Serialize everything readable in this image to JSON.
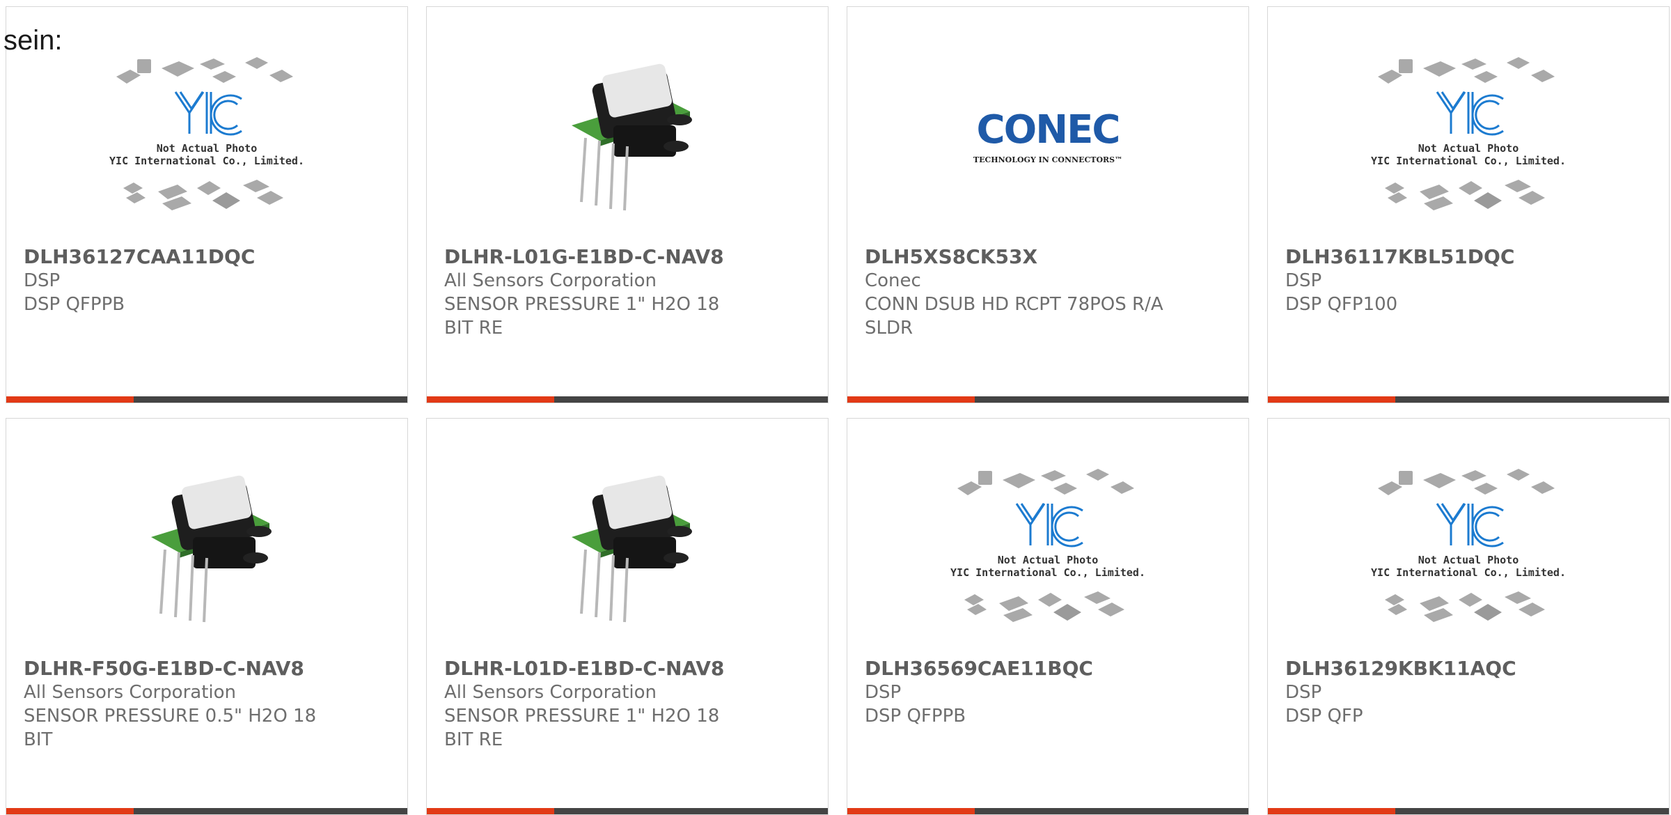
{
  "lead_text": "sein:",
  "brand": {
    "accent": "#e23a16",
    "bar_dark": "#444444",
    "yic_blue": "#1c7bd0",
    "conec_blue": "#1f5aa8"
  },
  "placeholder": {
    "line1": "Not Actual Photo",
    "line2": "YIC International Co., Limited."
  },
  "conec_logo": {
    "wordmark": "CONEC",
    "tagline": "TECHNOLOGY IN CONNECTORS™"
  },
  "products": [
    {
      "part_number": "DLH36127CAA11DQC",
      "manufacturer": "DSP",
      "description": "DSP QFPPB",
      "image": "yic-placeholder"
    },
    {
      "part_number": "DLHR-L01G-E1BD-C-NAV8",
      "manufacturer": "All Sensors Corporation",
      "description": "SENSOR PRESSURE 1\" H2O 18 BIT RE",
      "image": "pressure-sensor"
    },
    {
      "part_number": "DLH5XS8CK53X",
      "manufacturer": "Conec",
      "description": "CONN DSUB HD RCPT 78POS R/A SLDR",
      "image": "conec-logo"
    },
    {
      "part_number": "DLH36117KBL51DQC",
      "manufacturer": "DSP",
      "description": "DSP QFP100",
      "image": "yic-placeholder"
    },
    {
      "part_number": "DLHR-F50G-E1BD-C-NAV8",
      "manufacturer": "All Sensors Corporation",
      "description": "SENSOR PRESSURE 0.5\" H2O 18 BIT",
      "image": "pressure-sensor"
    },
    {
      "part_number": "DLHR-L01D-E1BD-C-NAV8",
      "manufacturer": "All Sensors Corporation",
      "description": "SENSOR PRESSURE 1\" H2O 18 BIT RE",
      "image": "pressure-sensor"
    },
    {
      "part_number": "DLH36569CAE11BQC",
      "manufacturer": "DSP",
      "description": "DSP QFPPB",
      "image": "yic-placeholder"
    },
    {
      "part_number": "DLH36129KBK11AQC",
      "manufacturer": "DSP",
      "description": "DSP QFP",
      "image": "yic-placeholder"
    }
  ]
}
